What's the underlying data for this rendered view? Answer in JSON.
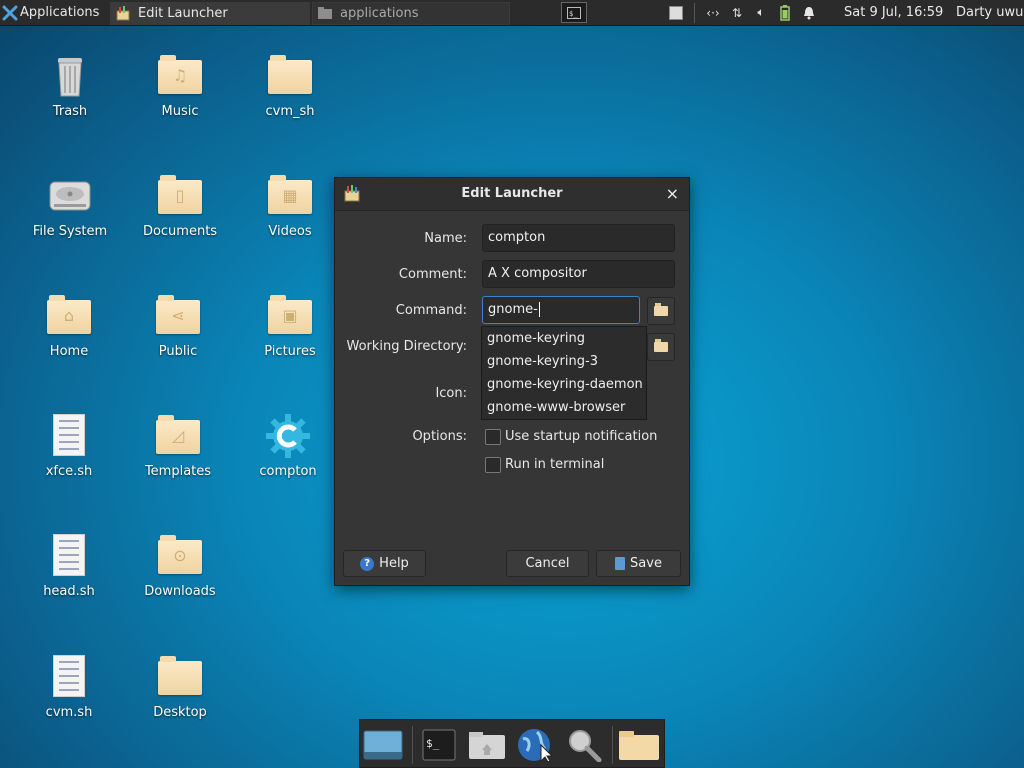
{
  "top_panel": {
    "applications_label": "Applications",
    "tasks": [
      {
        "label": "Edit Launcher"
      },
      {
        "label": "applications"
      }
    ],
    "clock": "Sat  9 Jul, 16:59",
    "user": "Darty uwu"
  },
  "desktop_icons": [
    {
      "label": "Trash"
    },
    {
      "label": "Music"
    },
    {
      "label": "cvm_sh"
    },
    {
      "label": "File System"
    },
    {
      "label": "Documents"
    },
    {
      "label": "Videos"
    },
    {
      "label": "Home"
    },
    {
      "label": "Public"
    },
    {
      "label": "Pictures"
    },
    {
      "label": "xfce.sh"
    },
    {
      "label": "Templates"
    },
    {
      "label": "compton"
    },
    {
      "label": "head.sh"
    },
    {
      "label": "Downloads"
    },
    {
      "label": "cvm.sh"
    },
    {
      "label": "Desktop"
    }
  ],
  "dialog": {
    "title": "Edit Launcher",
    "name_label": "Name:",
    "name_value": "compton",
    "comment_label": "Comment:",
    "comment_value": "A X compositor",
    "command_label": "Command:",
    "command_value": "gnome-",
    "workdir_label": "Working Directory:",
    "icon_label": "Icon:",
    "options_label": "Options:",
    "suggestions": [
      "gnome-keyring",
      "gnome-keyring-3",
      "gnome-keyring-daemon",
      "gnome-www-browser"
    ],
    "startup_notification_label": "Use startup notification",
    "run_in_terminal_label": "Run in terminal",
    "help_label": "Help",
    "cancel_label": "Cancel",
    "save_label": "Save"
  },
  "colors": {
    "panel_bg": "#2b2b2b",
    "dialog_bg": "#363636",
    "accent_focus": "#3d7fd1",
    "desktop_blue": "#0a86b8"
  }
}
